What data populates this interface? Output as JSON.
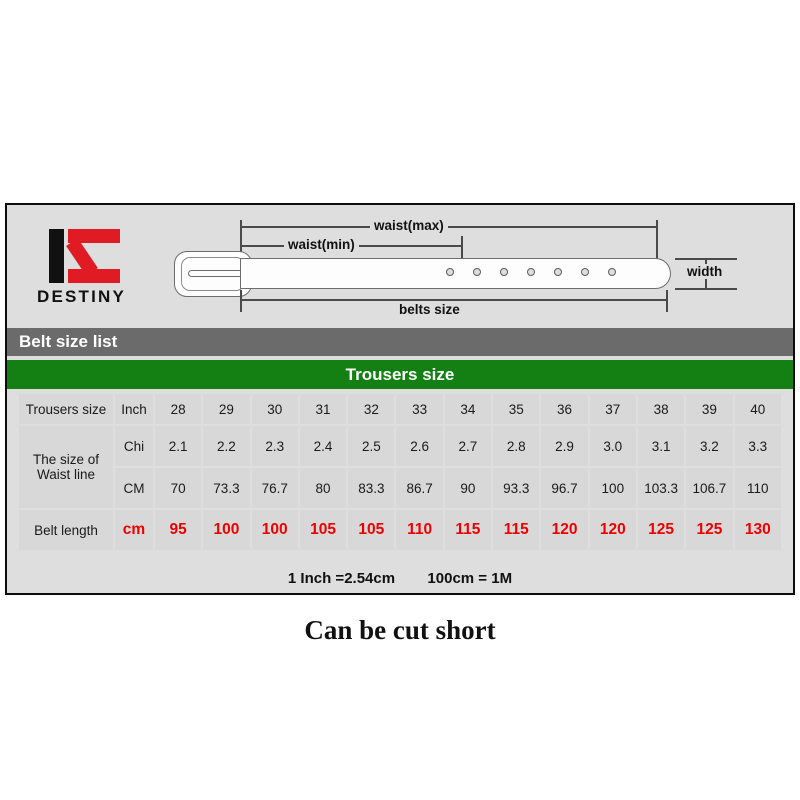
{
  "brand": {
    "logo_text": "DESTINY",
    "logo_icon": "iz-monogram-icon",
    "accent_red": "#e01b24",
    "accent_black": "#111111"
  },
  "diagram": {
    "name": "belt-measurement-diagram",
    "labels": {
      "waist_max": "waist(max)",
      "waist_min": "waist(min)",
      "belts_size": "belts size",
      "width": "width"
    },
    "holes_count": 7
  },
  "headers": {
    "gray_bar": "Belt size list",
    "green_bar": "Trousers size",
    "gray_color": "#6b6b6b",
    "green_color": "#148014"
  },
  "table": {
    "row_labels": {
      "trousers_size": "Trousers size",
      "waist_line_1": "The size of",
      "waist_line_2": "Waist line",
      "belt_length": "Belt length"
    },
    "units": {
      "inch": "Inch",
      "chi": "Chi",
      "cm": "CM",
      "belt_cm": "cm"
    },
    "rows": {
      "inch": [
        "28",
        "29",
        "30",
        "31",
        "32",
        "33",
        "34",
        "35",
        "36",
        "37",
        "38",
        "39",
        "40"
      ],
      "chi": [
        "2.1",
        "2.2",
        "2.3",
        "2.4",
        "2.5",
        "2.6",
        "2.7",
        "2.8",
        "2.9",
        "3.0",
        "3.1",
        "3.2",
        "3.3"
      ],
      "cm": [
        "70",
        "73.3",
        "76.7",
        "80",
        "83.3",
        "86.7",
        "90",
        "93.3",
        "96.7",
        "100",
        "103.3",
        "106.7",
        "110"
      ],
      "belt_length": [
        "95",
        "100",
        "100",
        "105",
        "105",
        "110",
        "115",
        "115",
        "120",
        "120",
        "125",
        "125",
        "130"
      ]
    },
    "belt_length_color": "#ee0000"
  },
  "footer": {
    "conversion_inch": "1 Inch =2.54cm",
    "conversion_meter": "100cm = 1M",
    "caption": "Can be cut short"
  }
}
